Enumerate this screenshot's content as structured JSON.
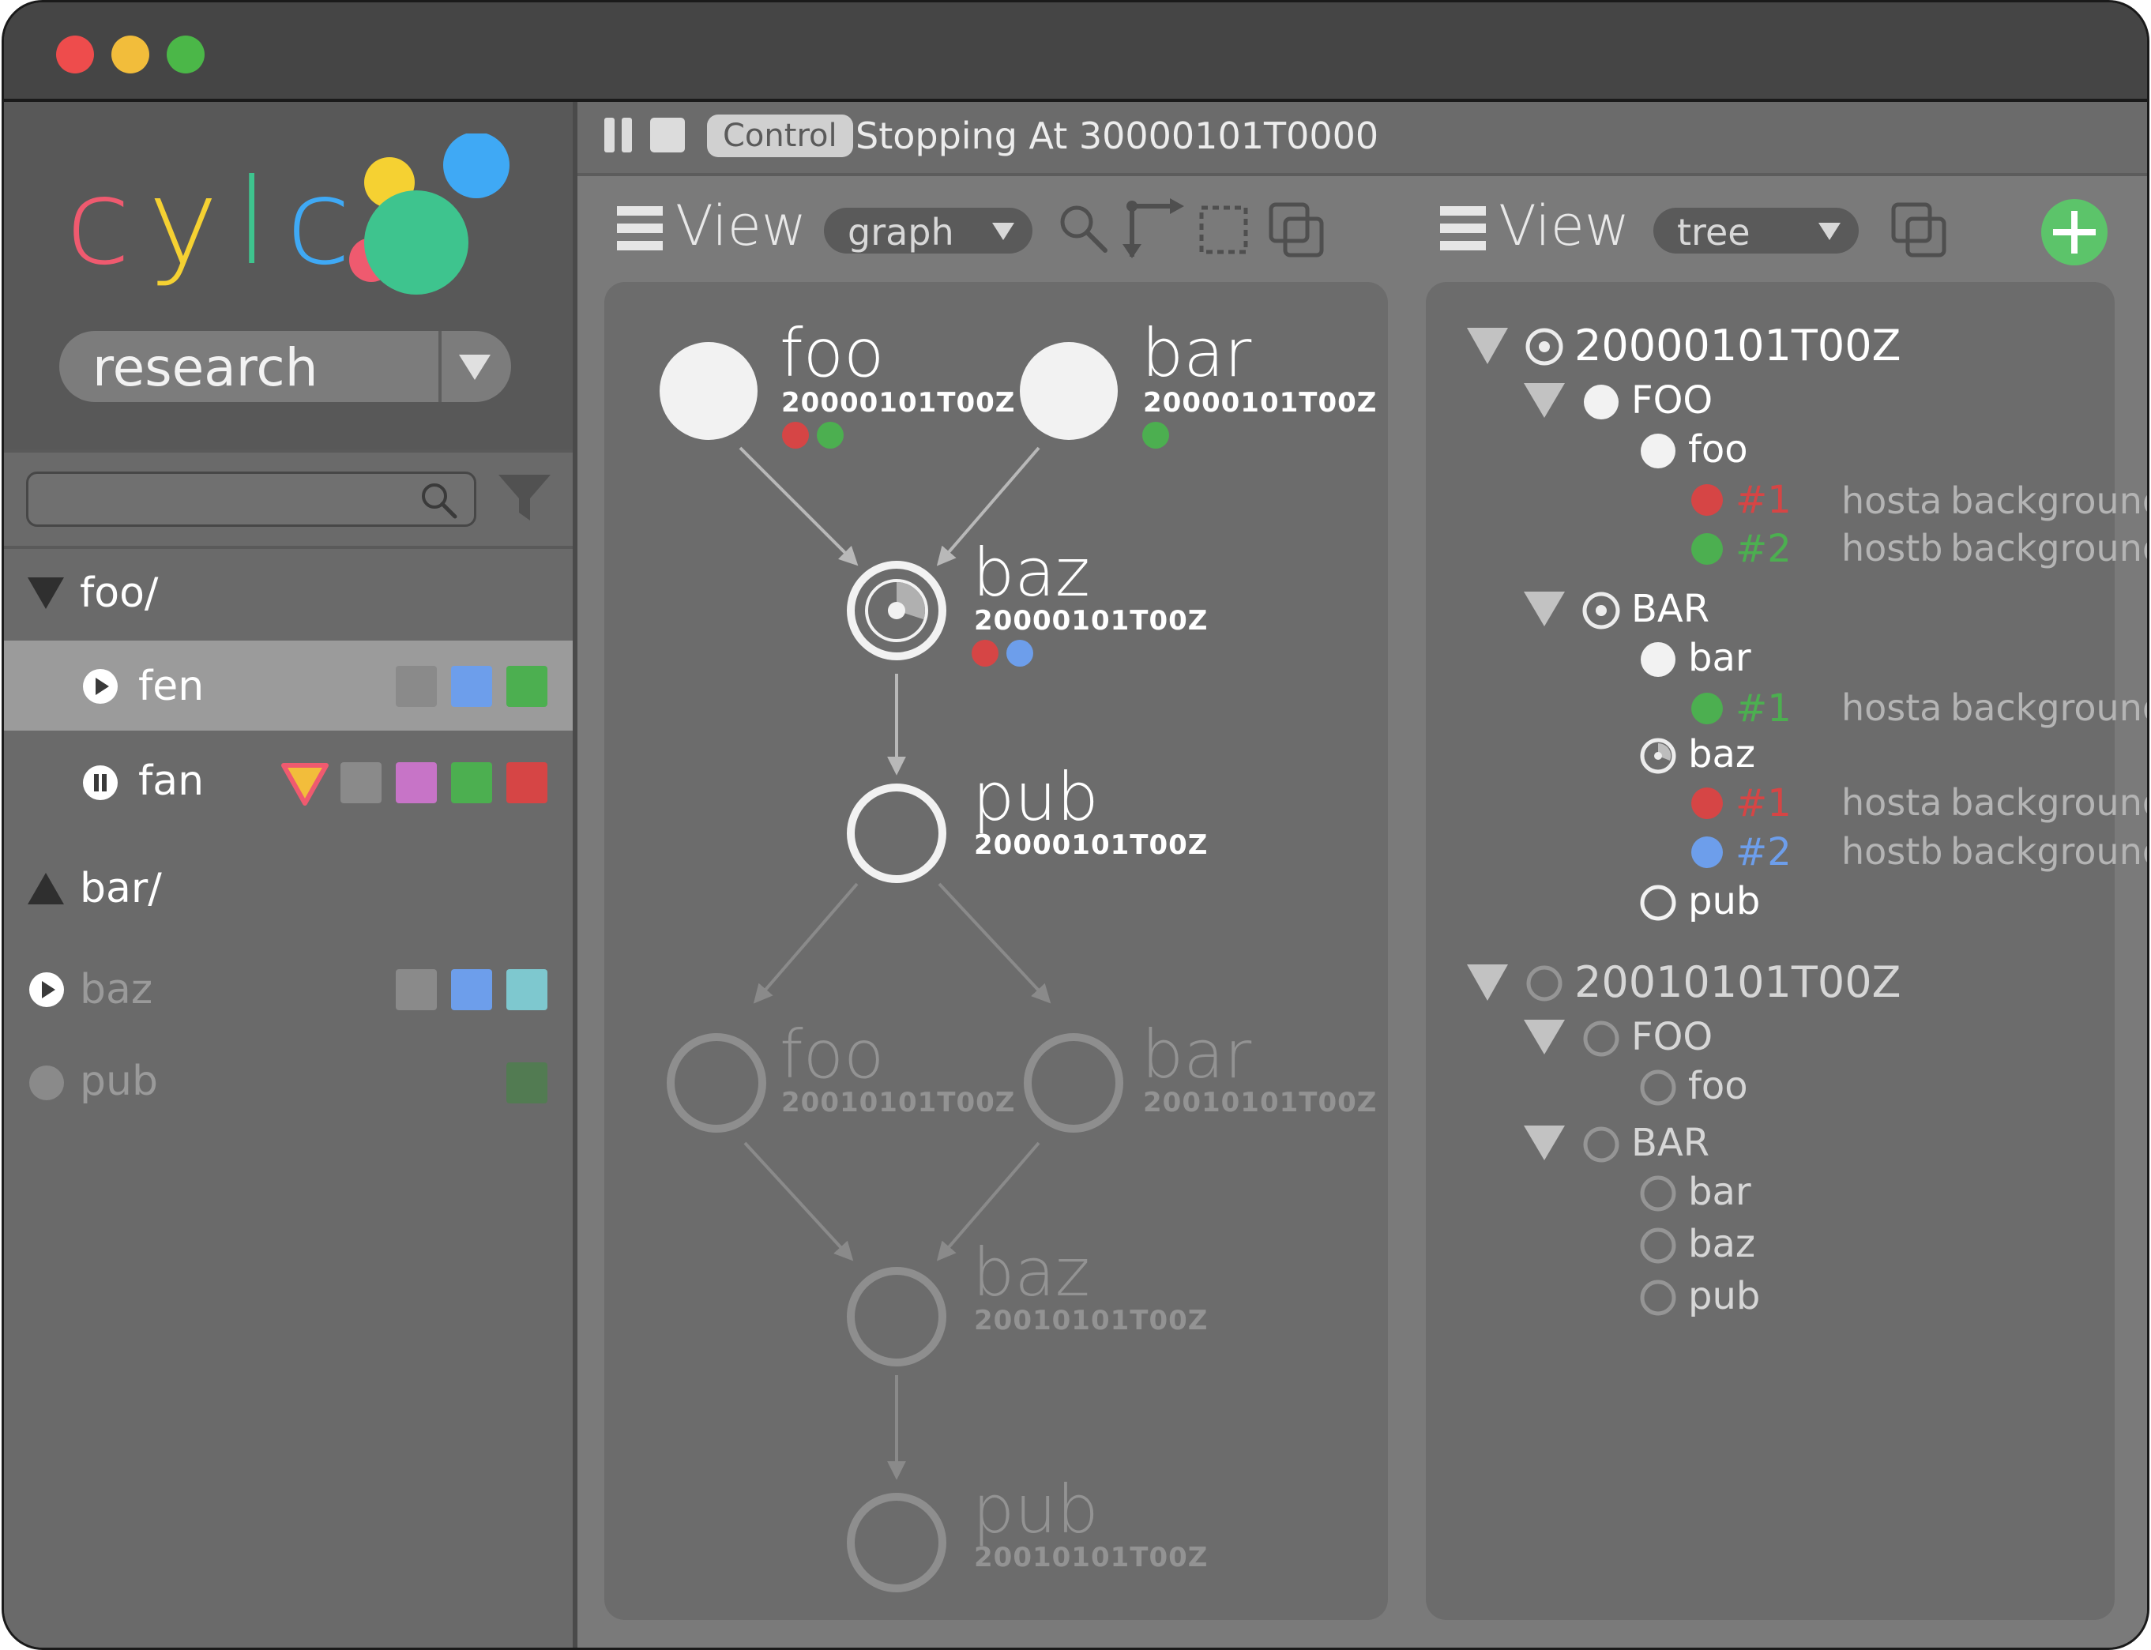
{
  "window": {
    "traffic_lights": [
      "#ee4c4c",
      "#f2bd3b",
      "#4bb748"
    ]
  },
  "sidebar": {
    "logo_letters": [
      {
        "char": "c",
        "color": "#ef5a6f"
      },
      {
        "char": "y",
        "color": "#f5d132"
      },
      {
        "char": "l",
        "color": "#3ec48e"
      },
      {
        "char": "c",
        "color": "#3fa9f5"
      }
    ],
    "logo_dot_colors": [
      "#f5d132",
      "#3fa9f5",
      "#ef5a6f",
      "#3ec48e"
    ],
    "workflow_selector": "research",
    "search_placeholder": "",
    "groups": [
      {
        "label": "foo/",
        "expanded": true
      },
      {
        "label": "bar/",
        "expanded": false
      }
    ],
    "workflows": [
      {
        "label": "fen",
        "state": "running",
        "state_icon": "play-icon",
        "highlighted": true,
        "squares": [
          "#8a8a8a",
          "#6d9eeb",
          "#4caf50"
        ]
      },
      {
        "label": "fan",
        "state": "paused",
        "state_icon": "pause-icon",
        "warning_icon": "warning-triangle-icon",
        "squares": [
          "#8a8a8a",
          "#c774c7",
          "#4caf50",
          "#d64545"
        ]
      },
      {
        "label": "baz",
        "state": "running",
        "state_icon": "play-icon",
        "dimmed": true,
        "squares": [
          "#8a8a8a",
          "#6d9eeb",
          "#7ec8cf"
        ]
      },
      {
        "label": "pub",
        "state": "stopped",
        "state_icon": "stopped-icon",
        "dimmed": true,
        "squares": [
          "#527b52"
        ]
      }
    ]
  },
  "toolbar": {
    "control_label": "Control",
    "status_text": "Stopping At 30000101T0000"
  },
  "graph_view": {
    "view_label": "View",
    "view_type": "graph",
    "nodes": [
      {
        "name": "foo",
        "point": "20000101T00Z",
        "state": "succeeded",
        "jobs": [
          "#d64545",
          "#4caf50"
        ],
        "dim": false
      },
      {
        "name": "bar",
        "point": "20000101T00Z",
        "state": "succeeded",
        "jobs": [
          "#4caf50"
        ],
        "dim": false
      },
      {
        "name": "baz",
        "point": "20000101T00Z",
        "state": "running",
        "progress": 0.3,
        "jobs": [
          "#d64545",
          "#6d9eeb"
        ],
        "dim": false
      },
      {
        "name": "pub",
        "point": "20000101T00Z",
        "state": "waiting",
        "jobs": [],
        "dim": false
      },
      {
        "name": "foo",
        "point": "20010101T00Z",
        "state": "waiting",
        "jobs": [],
        "dim": true
      },
      {
        "name": "bar",
        "point": "20010101T00Z",
        "state": "waiting",
        "jobs": [],
        "dim": true
      },
      {
        "name": "baz",
        "point": "20010101T00Z",
        "state": "waiting",
        "jobs": [],
        "dim": true
      },
      {
        "name": "pub",
        "point": "20010101T00Z",
        "state": "waiting",
        "jobs": [],
        "dim": true
      }
    ]
  },
  "tree_view": {
    "view_label": "View",
    "view_type": "tree",
    "rows": [
      {
        "kind": "cycle",
        "label": "20000101T00Z",
        "expander": "down",
        "icon": "running",
        "dim": false
      },
      {
        "kind": "family",
        "label": "FOO",
        "expander": "down",
        "icon": "succeeded",
        "dim": false
      },
      {
        "kind": "task",
        "label": "foo",
        "icon": "succeeded",
        "dim": false
      },
      {
        "kind": "job",
        "label": "#1",
        "color": "#d64545",
        "host": "hosta",
        "runner": "background"
      },
      {
        "kind": "job",
        "label": "#2",
        "color": "#4caf50",
        "host": "hostb",
        "runner": "background"
      },
      {
        "kind": "family",
        "label": "BAR",
        "expander": "down",
        "icon": "running",
        "dim": false
      },
      {
        "kind": "task",
        "label": "bar",
        "icon": "succeeded",
        "dim": false
      },
      {
        "kind": "job",
        "label": "#1",
        "color": "#4caf50",
        "host": "hosta",
        "runner": "background"
      },
      {
        "kind": "task",
        "label": "baz",
        "icon": "running",
        "dim": false
      },
      {
        "kind": "job",
        "label": "#1",
        "color": "#d64545",
        "host": "hosta",
        "runner": "background"
      },
      {
        "kind": "job",
        "label": "#2",
        "color": "#6d9eeb",
        "host": "hostb",
        "runner": "background"
      },
      {
        "kind": "task",
        "label": "pub",
        "icon": "waiting",
        "dim": false
      },
      {
        "kind": "cycle",
        "label": "20010101T00Z",
        "expander": "down",
        "icon": "waiting",
        "dim": true
      },
      {
        "kind": "family",
        "label": "FOO",
        "expander": "down",
        "icon": "waiting",
        "dim": true
      },
      {
        "kind": "task",
        "label": "foo",
        "icon": "waiting",
        "dim": true
      },
      {
        "kind": "family",
        "label": "BAR",
        "expander": "down",
        "icon": "waiting",
        "dim": true
      },
      {
        "kind": "task",
        "label": "bar",
        "icon": "waiting",
        "dim": true
      },
      {
        "kind": "task",
        "label": "baz",
        "icon": "waiting",
        "dim": true
      },
      {
        "kind": "task",
        "label": "pub",
        "icon": "waiting",
        "dim": true
      }
    ]
  },
  "colors": {
    "add_button": "#5cc46a"
  }
}
